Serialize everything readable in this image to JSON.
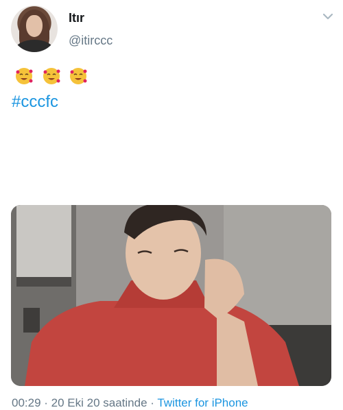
{
  "author": {
    "display_name": "Itır",
    "handle": "@itirccc",
    "avatar_icon": "profile-photo-icon"
  },
  "tweet": {
    "lines": [],
    "hashtag": "#cccfc"
  },
  "icons": {
    "more": "chevron-down-icon",
    "emoji": "smiling-face-with-hearts-icon"
  },
  "footer": {
    "timestamp": "00:29 · 20 Eki 20 saatinde ·",
    "via": "Twitter for iPhone"
  },
  "colors": {
    "link": "#1b95e0",
    "secondary_text": "#657786",
    "sweater": "#c2453f"
  }
}
